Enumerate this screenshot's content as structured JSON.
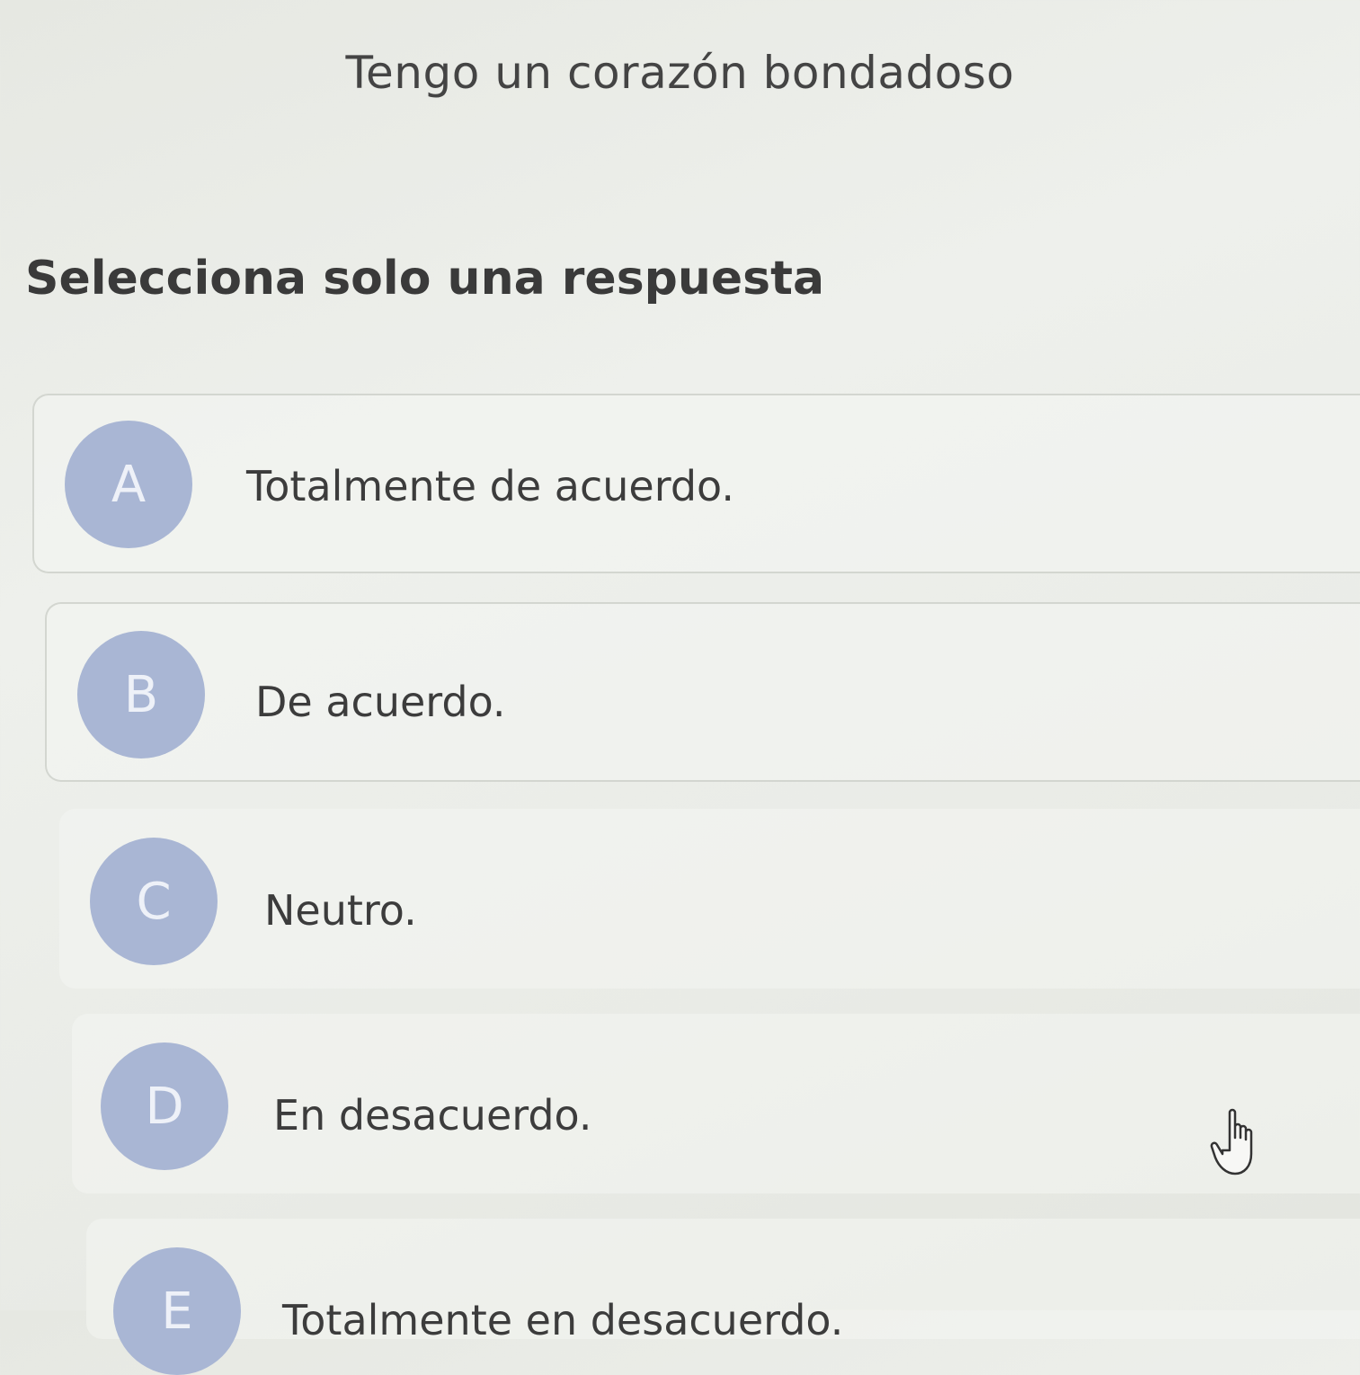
{
  "question": {
    "title": "Tengo un corazón bondadoso"
  },
  "instruction": "Selecciona solo una respuesta",
  "options": [
    {
      "letter": "A",
      "text": "Totalmente de acuerdo."
    },
    {
      "letter": "B",
      "text": "De acuerdo."
    },
    {
      "letter": "C",
      "text": "Neutro."
    },
    {
      "letter": "D",
      "text": "En desacuerdo."
    },
    {
      "letter": "E",
      "text": "Totalmente en desacuerdo."
    }
  ],
  "colors": {
    "letter_circle": "#a9b6d4",
    "background": "#eceee9",
    "text": "#3c3c3c"
  },
  "icons": {
    "cursor": "hand-pointer-icon"
  }
}
